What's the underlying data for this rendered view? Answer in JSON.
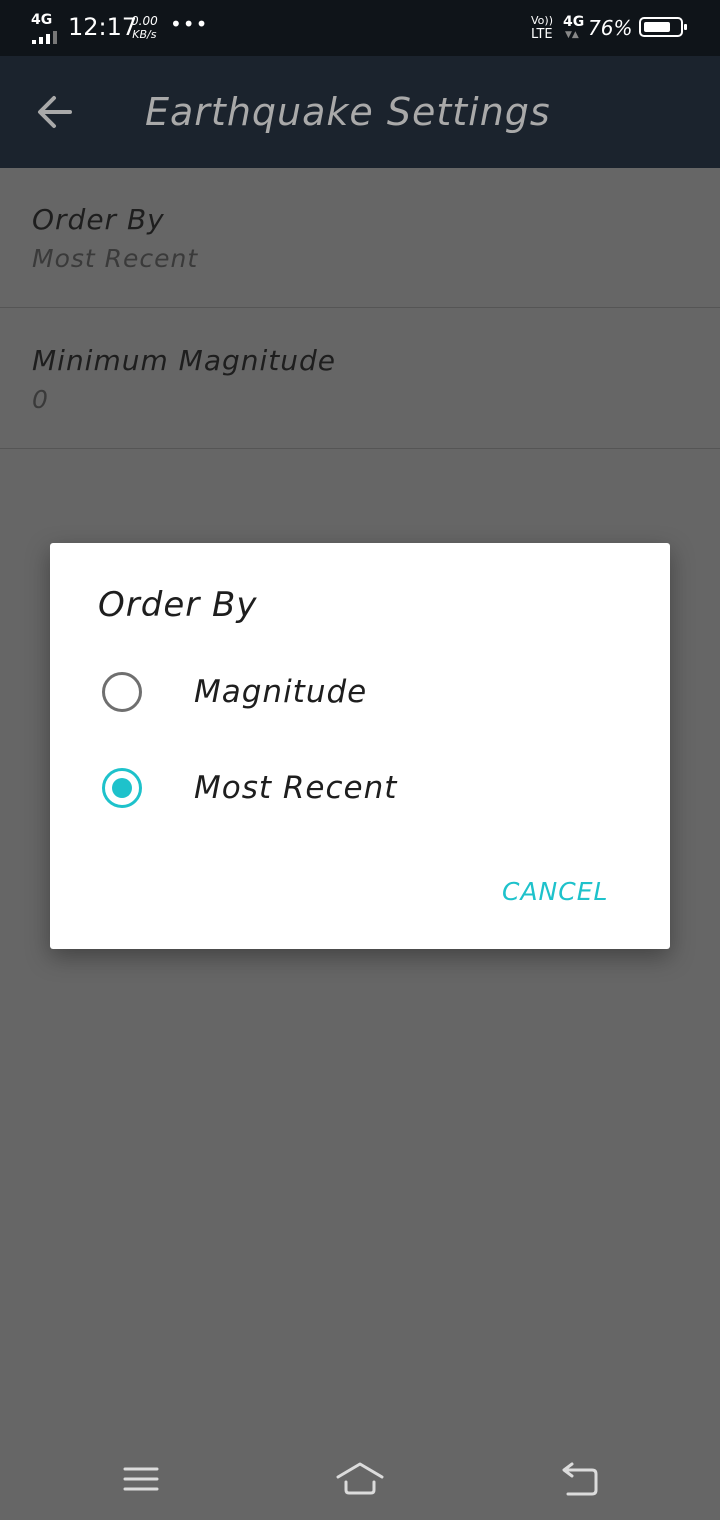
{
  "status_bar": {
    "network_left": "4G",
    "time": "12:17",
    "speed_value": "0.00",
    "speed_unit": "KB/s",
    "more": "•••",
    "volte_top": "Vo))",
    "volte_bottom": "LTE",
    "network_right": "4G",
    "battery_percent": "76%",
    "battery_level": 0.76
  },
  "app_bar": {
    "title": "Earthquake Settings",
    "back_icon": "arrow-left-icon"
  },
  "preferences": [
    {
      "title": "Order By",
      "summary": "Most Recent"
    },
    {
      "title": "Minimum Magnitude",
      "summary": "0"
    }
  ],
  "dialog": {
    "title": "Order By",
    "options": [
      {
        "label": "Magnitude",
        "selected": false
      },
      {
        "label": "Most Recent",
        "selected": true
      }
    ],
    "cancel_label": "CANCEL"
  },
  "nav_bar": {
    "icons": [
      "menu-icon",
      "home-icon",
      "back-icon"
    ]
  },
  "colors": {
    "accent": "#1ec2cb",
    "app_bar": "#1b232d",
    "status_bar": "#0f1419",
    "scrim_background": "#666666"
  }
}
